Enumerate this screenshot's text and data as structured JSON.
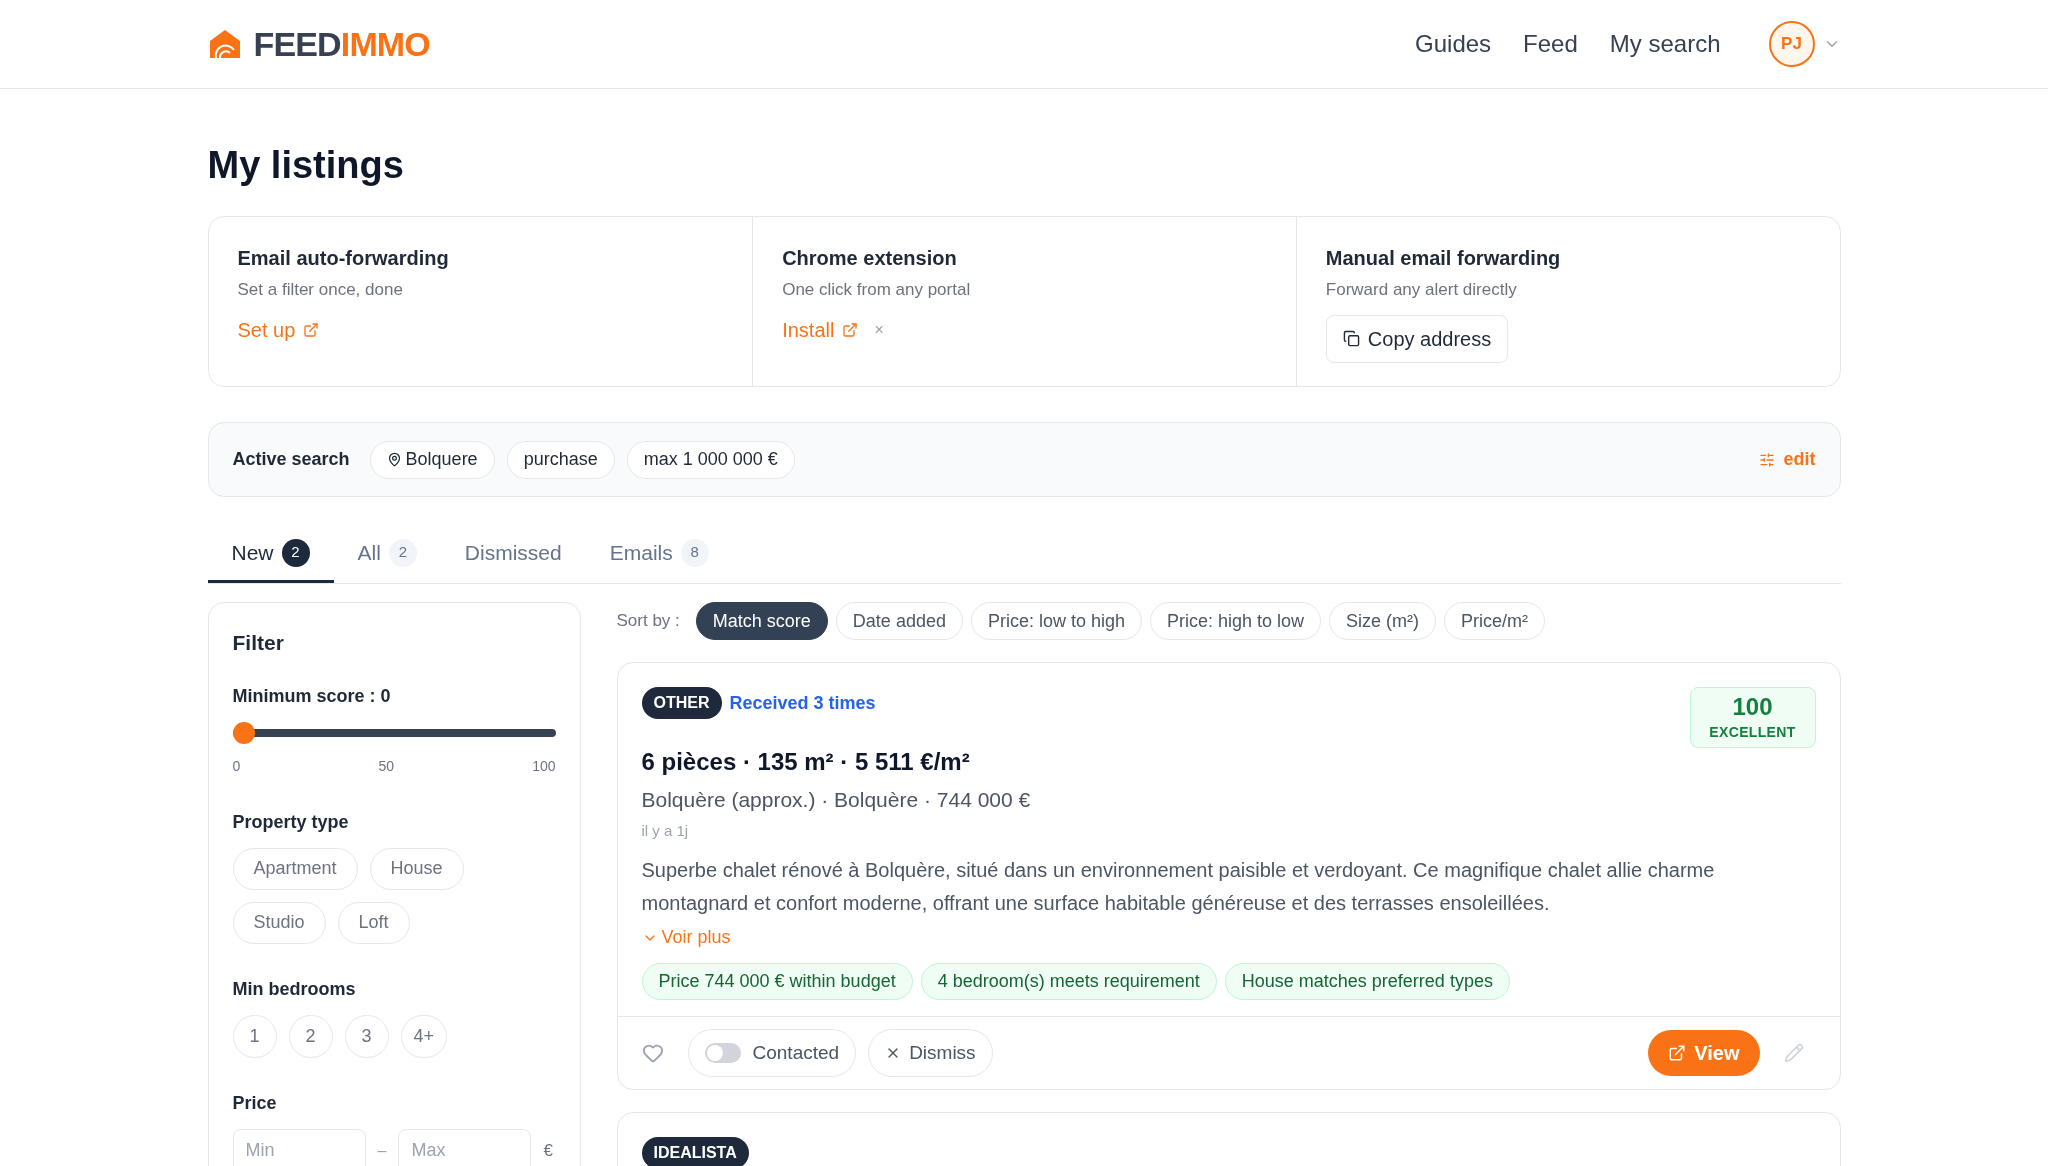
{
  "brand": {
    "part_1": "FEED",
    "part_2": "IMMO"
  },
  "nav": [
    {
      "label": "Guides"
    },
    {
      "label": "Feed"
    },
    {
      "label": "My search"
    }
  ],
  "user": {
    "initials": "PJ"
  },
  "page_title": "My listings",
  "import_cards": [
    {
      "kind": "link",
      "title": "Email auto-forwarding",
      "subtitle": "Set a filter once, done",
      "action": "Set up"
    },
    {
      "kind": "link",
      "title": "Chrome extension",
      "subtitle": "One click from any portal",
      "action": "Install",
      "dismiss": "×"
    },
    {
      "kind": "button",
      "title": "Manual email forwarding",
      "subtitle": "Forward any alert directly",
      "action": "Copy address"
    }
  ],
  "active_search": {
    "label": "Active search",
    "chips": [
      {
        "kind": "location",
        "text": "Bolquere"
      },
      {
        "kind": "plain",
        "text": "purchase"
      },
      {
        "kind": "plain",
        "text": "max 1 000 000 €"
      }
    ],
    "edit": "edit"
  },
  "tabs": [
    {
      "label": "New",
      "count": "2",
      "selected": true
    },
    {
      "label": "All",
      "count": "2",
      "selected": false
    },
    {
      "label": "Dismissed",
      "selected": false
    },
    {
      "label": "Emails",
      "count": "8",
      "selected": false
    }
  ],
  "filter": {
    "title": "Filter",
    "min_score": {
      "label": "Minimum score : 0",
      "level": 0,
      "ticks": [
        "0",
        "50",
        "100"
      ]
    },
    "property_type": {
      "label": "Property type",
      "options": [
        {
          "label": "Apartment",
          "selected": false
        },
        {
          "label": "House",
          "selected": false
        },
        {
          "label": "Studio",
          "selected": false
        },
        {
          "label": "Loft",
          "selected": false
        }
      ]
    },
    "min_bedrooms": {
      "label": "Min bedrooms",
      "options": [
        {
          "label": "1",
          "selected": false
        },
        {
          "label": "2",
          "selected": false
        },
        {
          "label": "3",
          "selected": false
        },
        {
          "label": "4+",
          "selected": false
        }
      ]
    },
    "price": {
      "label": "Price",
      "min_placeholder": "Min",
      "separator": "–",
      "max_placeholder": "Max",
      "currency": "€"
    }
  },
  "sort": {
    "label": "Sort by :",
    "options": [
      {
        "label": "Match score",
        "selected": true
      },
      {
        "label": "Date added",
        "selected": false
      },
      {
        "label": "Price: low to high",
        "selected": false
      },
      {
        "label": "Price: high to low",
        "selected": false
      },
      {
        "label": "Size (m²)",
        "selected": false
      },
      {
        "label": "Price/m²",
        "selected": false
      }
    ]
  },
  "listings": [
    {
      "source": "OTHER",
      "received": "Received 3 times",
      "score": "100",
      "score_label": "EXCELLENT",
      "title": "6 pièces · 135 m² · 5 511 €/m²",
      "location": "Bolquère (approx.) · Bolquère · 744 000 €",
      "age": "il y a 1j",
      "description": "Superbe chalet rénové à Bolquère, situé dans un environnement paisible et verdoyant. Ce magnifique chalet allie charme montagnard et confort moderne, offrant une surface habitable généreuse et des terrasses ensoleillées.",
      "more": "Voir plus",
      "matches": [
        "Price 744 000 € within budget",
        "4 bedroom(s) meets requirement",
        "House matches preferred types"
      ],
      "favorite": false,
      "contacted": {
        "label": "Contacted",
        "on": false
      },
      "dismiss": "Dismiss",
      "view": "View"
    },
    {
      "source": "IDEALISTA"
    }
  ]
}
